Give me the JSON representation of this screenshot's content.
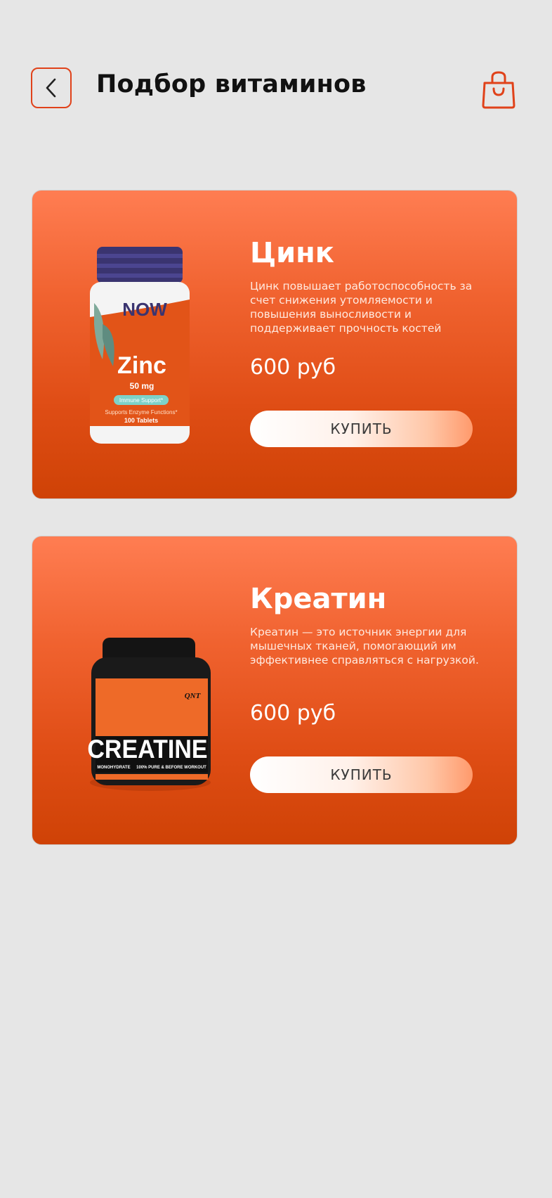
{
  "header": {
    "title": "Подбор витаминов",
    "back_icon": "chevron-left-icon",
    "cart_icon": "shopping-bag-icon",
    "accent_color": "#e0421a"
  },
  "products": [
    {
      "name": "Цинк",
      "description": "Цинк повышает работоспособность за счет снижения утомляемости и повышения выносливости и поддерживает прочность костей",
      "price": "600 руб",
      "buy_label": "КУПИТЬ",
      "image": {
        "brand": "NOW",
        "name": "Zinc",
        "dose": "50 mg",
        "badge": "Immune Support*",
        "claim": "Supports Enzyme Functions*",
        "count": "100 Tablets"
      }
    },
    {
      "name": "Креатин",
      "description": "Креатин — это источник энергии для мышечных тканей, помогающий им эффективнее справляться с нагрузкой.",
      "price": "600 руб",
      "buy_label": "КУПИТЬ",
      "image": {
        "brand": "QNT",
        "name": "CREATINE",
        "subtitle": "MONOHYDRATE",
        "claim": "100% PURE & BEFORE WORKOUT"
      }
    }
  ]
}
